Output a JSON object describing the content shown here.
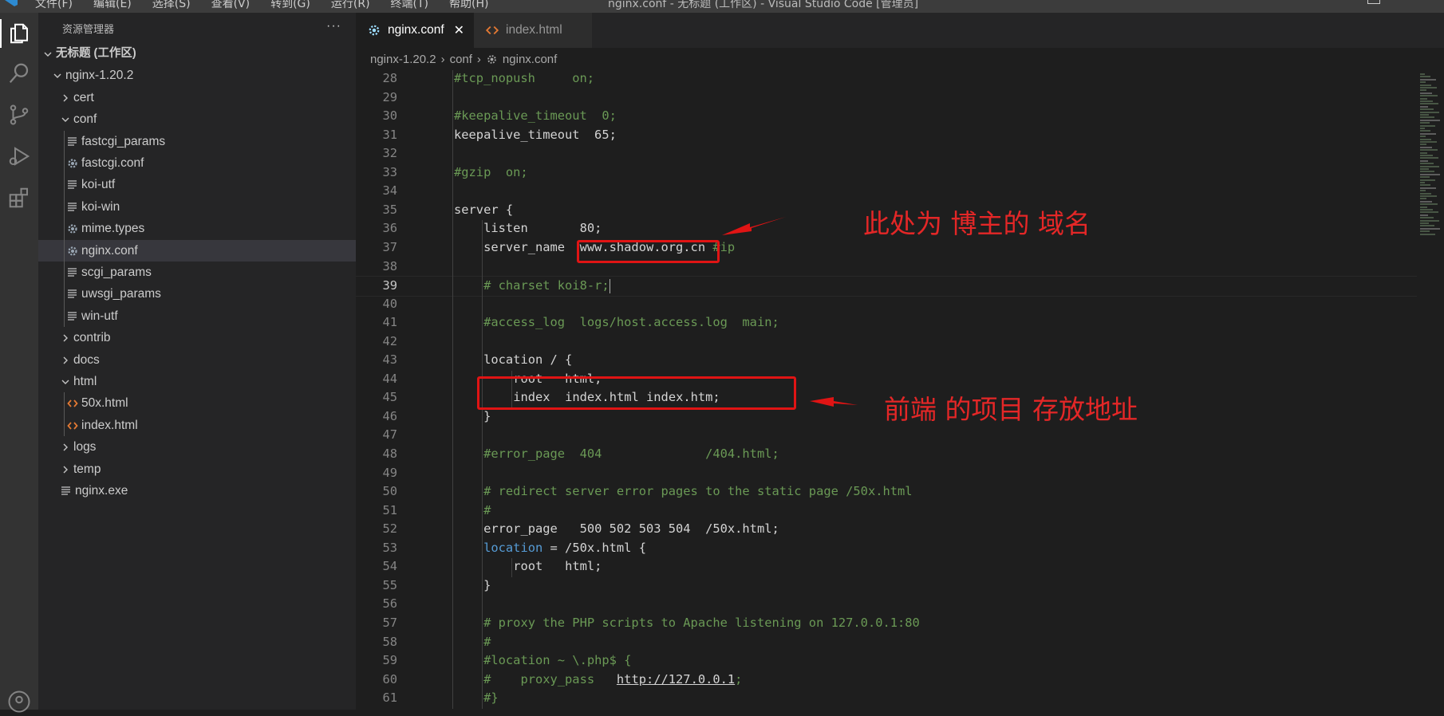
{
  "titlebar": {
    "menu": [
      "文件(F)",
      "编辑(E)",
      "选择(S)",
      "查看(V)",
      "转到(G)",
      "运行(R)",
      "终端(T)",
      "帮助(H)"
    ],
    "window_title": "nginx.conf - 无标题 (工作区) - Visual Studio Code [管理员]"
  },
  "activity_bar": {
    "icons": [
      "explorer-icon",
      "search-icon",
      "source-control-icon",
      "run-debug-icon",
      "extensions-icon",
      "accounts-icon"
    ]
  },
  "sidebar": {
    "title": "资源管理器",
    "more": "···",
    "tree": [
      {
        "label": "无标题 (工作区)",
        "kind": "workspace",
        "depth": 0,
        "expanded": true
      },
      {
        "label": "nginx-1.20.2",
        "kind": "folder",
        "depth": 1,
        "expanded": true
      },
      {
        "label": "cert",
        "kind": "folder",
        "depth": 2,
        "expanded": false
      },
      {
        "label": "conf",
        "kind": "folder",
        "depth": 2,
        "expanded": true
      },
      {
        "label": "fastcgi_params",
        "kind": "file-lines",
        "depth": 3
      },
      {
        "label": "fastcgi.conf",
        "kind": "file-gear",
        "depth": 3
      },
      {
        "label": "koi-utf",
        "kind": "file-lines",
        "depth": 3
      },
      {
        "label": "koi-win",
        "kind": "file-lines",
        "depth": 3
      },
      {
        "label": "mime.types",
        "kind": "file-gear",
        "depth": 3
      },
      {
        "label": "nginx.conf",
        "kind": "file-gear",
        "depth": 3,
        "selected": true
      },
      {
        "label": "scgi_params",
        "kind": "file-lines",
        "depth": 3
      },
      {
        "label": "uwsgi_params",
        "kind": "file-lines",
        "depth": 3
      },
      {
        "label": "win-utf",
        "kind": "file-lines",
        "depth": 3
      },
      {
        "label": "contrib",
        "kind": "folder",
        "depth": 2,
        "expanded": false
      },
      {
        "label": "docs",
        "kind": "folder",
        "depth": 2,
        "expanded": false
      },
      {
        "label": "html",
        "kind": "folder",
        "depth": 2,
        "expanded": true
      },
      {
        "label": "50x.html",
        "kind": "file-html",
        "depth": 3
      },
      {
        "label": "index.html",
        "kind": "file-html",
        "depth": 3
      },
      {
        "label": "logs",
        "kind": "folder",
        "depth": 2,
        "expanded": false
      },
      {
        "label": "temp",
        "kind": "folder",
        "depth": 2,
        "expanded": false
      },
      {
        "label": "nginx.exe",
        "kind": "file-lines",
        "depth": 2
      }
    ]
  },
  "tabs": [
    {
      "label": "nginx.conf",
      "icon": "gear-icon",
      "active": true,
      "close": "✕"
    },
    {
      "label": "index.html",
      "icon": "html-icon",
      "active": false
    }
  ],
  "breadcrumb": [
    "nginx-1.20.2",
    "conf",
    "nginx.conf"
  ],
  "code": {
    "current_line": 39,
    "lines": [
      {
        "n": 28,
        "indent": 1,
        "segs": [
          [
            "com",
            "#tcp_nopush     on;"
          ]
        ]
      },
      {
        "n": 29,
        "indent": 0,
        "segs": []
      },
      {
        "n": 30,
        "indent": 1,
        "segs": [
          [
            "com",
            "#keepalive_timeout  0;"
          ]
        ]
      },
      {
        "n": 31,
        "indent": 1,
        "segs": [
          [
            "def",
            "keepalive_timeout  65;"
          ]
        ]
      },
      {
        "n": 32,
        "indent": 0,
        "segs": []
      },
      {
        "n": 33,
        "indent": 1,
        "segs": [
          [
            "com",
            "#gzip  on;"
          ]
        ]
      },
      {
        "n": 34,
        "indent": 0,
        "segs": []
      },
      {
        "n": 35,
        "indent": 1,
        "segs": [
          [
            "def",
            "server {"
          ]
        ]
      },
      {
        "n": 36,
        "indent": 2,
        "segs": [
          [
            "def",
            "listen       80;"
          ]
        ]
      },
      {
        "n": 37,
        "indent": 2,
        "segs": [
          [
            "def",
            "server_name  www.shadow.org.cn"
          ],
          [
            "com",
            " #ip"
          ]
        ]
      },
      {
        "n": 38,
        "indent": 0,
        "segs": []
      },
      {
        "n": 39,
        "indent": 2,
        "segs": [
          [
            "com",
            "# charset koi8-r;"
          ]
        ]
      },
      {
        "n": 40,
        "indent": 0,
        "segs": []
      },
      {
        "n": 41,
        "indent": 2,
        "segs": [
          [
            "com",
            "#access_log  logs/host.access.log  main;"
          ]
        ]
      },
      {
        "n": 42,
        "indent": 0,
        "segs": []
      },
      {
        "n": 43,
        "indent": 2,
        "segs": [
          [
            "def",
            "location / {"
          ]
        ]
      },
      {
        "n": 44,
        "indent": 3,
        "segs": [
          [
            "def",
            "root   html;"
          ]
        ]
      },
      {
        "n": 45,
        "indent": 3,
        "segs": [
          [
            "def",
            "index  index.html index.htm;"
          ]
        ]
      },
      {
        "n": 46,
        "indent": 2,
        "segs": [
          [
            "def",
            "}"
          ]
        ]
      },
      {
        "n": 47,
        "indent": 0,
        "segs": []
      },
      {
        "n": 48,
        "indent": 2,
        "segs": [
          [
            "com",
            "#error_page  404              /404.html;"
          ]
        ]
      },
      {
        "n": 49,
        "indent": 0,
        "segs": []
      },
      {
        "n": 50,
        "indent": 2,
        "segs": [
          [
            "com",
            "# redirect server error pages to the static page /50x.html"
          ]
        ]
      },
      {
        "n": 51,
        "indent": 2,
        "segs": [
          [
            "com",
            "#"
          ]
        ]
      },
      {
        "n": 52,
        "indent": 2,
        "segs": [
          [
            "def",
            "error_page   500 502 503 504  /50x.html;"
          ]
        ]
      },
      {
        "n": 53,
        "indent": 2,
        "segs": [
          [
            "kw",
            "location"
          ],
          [
            "def",
            " = /50x.html {"
          ]
        ]
      },
      {
        "n": 54,
        "indent": 3,
        "segs": [
          [
            "def",
            "root   html;"
          ]
        ]
      },
      {
        "n": 55,
        "indent": 2,
        "segs": [
          [
            "def",
            "}"
          ]
        ]
      },
      {
        "n": 56,
        "indent": 0,
        "segs": []
      },
      {
        "n": 57,
        "indent": 2,
        "segs": [
          [
            "com",
            "# proxy the PHP scripts to Apache listening on 127.0.0.1:80"
          ]
        ]
      },
      {
        "n": 58,
        "indent": 2,
        "segs": [
          [
            "com",
            "#"
          ]
        ]
      },
      {
        "n": 59,
        "indent": 2,
        "segs": [
          [
            "com",
            "#location ~ \\.php$ {"
          ]
        ]
      },
      {
        "n": 60,
        "indent": 2,
        "segs": [
          [
            "com",
            "#    proxy_pass   "
          ],
          [
            "url",
            "http://127.0.0.1"
          ],
          [
            "com",
            ";"
          ]
        ]
      },
      {
        "n": 61,
        "indent": 2,
        "segs": [
          [
            "com",
            "#}"
          ]
        ]
      }
    ]
  },
  "annotations": {
    "domain_note": "此处为 博主的 域名",
    "frontend_note": "前端 的项目 存放地址",
    "color": "#e42727"
  },
  "colors": {
    "comment": "#6a9955",
    "keyword": "#569cd6",
    "html_icon": "#e37933",
    "annotation_red": "#e01414"
  }
}
